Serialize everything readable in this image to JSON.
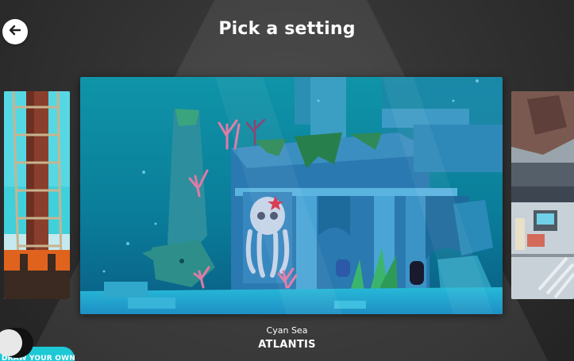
{
  "header": {
    "title": "Pick a setting",
    "back_icon": "arrow-left-icon"
  },
  "carousel": {
    "selected": {
      "subtitle": "Cyan Sea",
      "name": "ATLANTIS"
    },
    "cards": [
      {
        "id": "left",
        "scene": "tower-rope-ladder",
        "state": "partial"
      },
      {
        "id": "center",
        "scene": "underwater-ruins",
        "state": "selected"
      },
      {
        "id": "right",
        "scene": "spaceship-interior",
        "state": "partial"
      }
    ]
  },
  "footer": {
    "draw_own_label": "DRAW YOUR OWN"
  },
  "colors": {
    "background": "#2f2f2f",
    "accent": "#1ec9d6",
    "text": "#ffffff"
  }
}
